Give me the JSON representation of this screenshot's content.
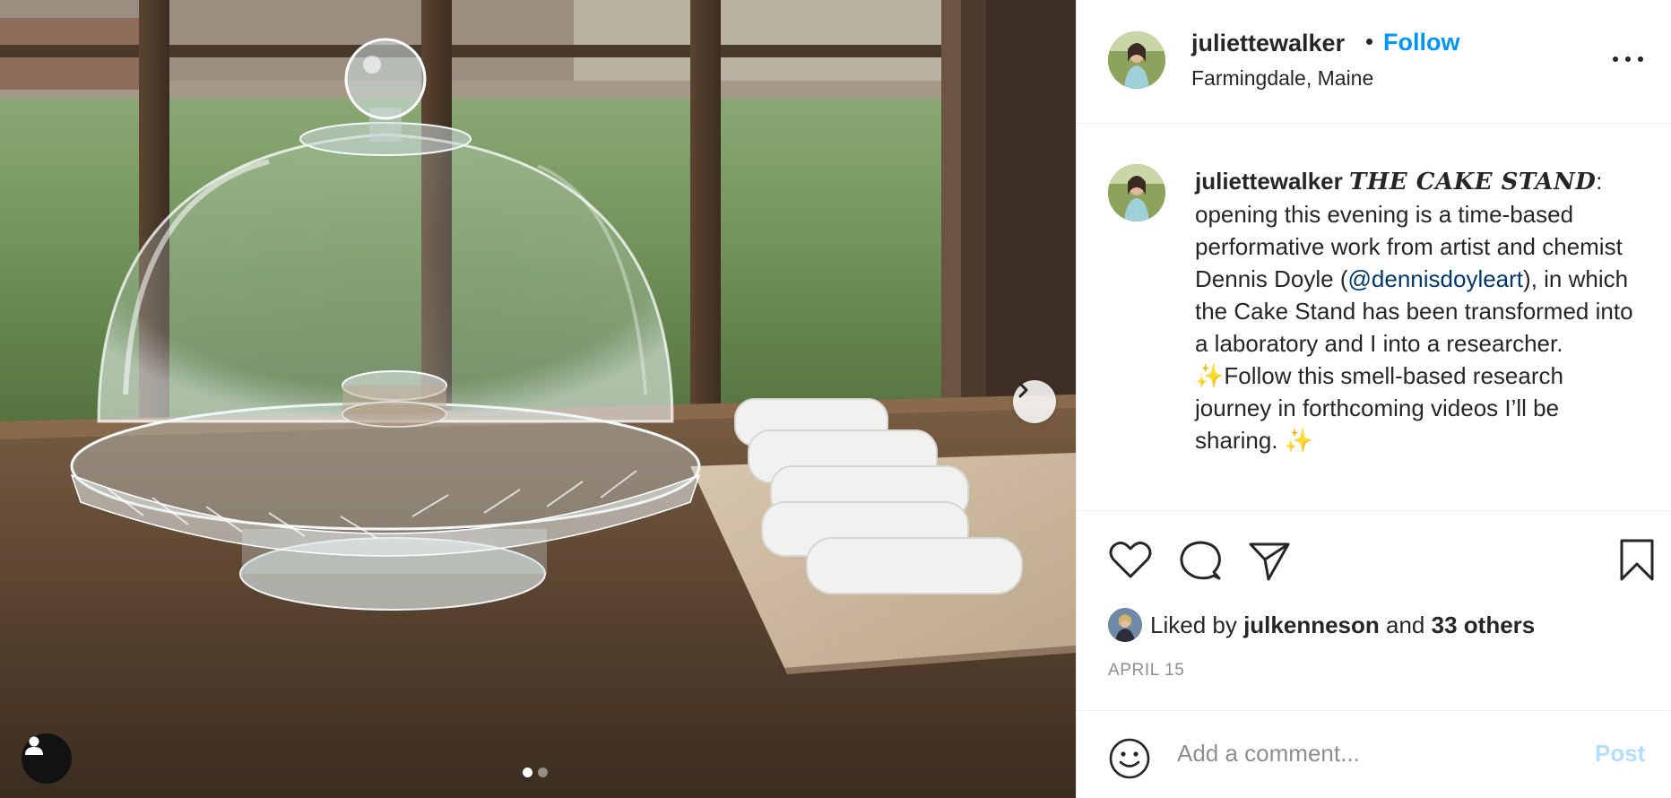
{
  "post": {
    "username": "juliettewalker",
    "separator": "•",
    "follow_label": "Follow",
    "location": "Farmingdale, Maine",
    "more_icon": "more-horizontal-icon"
  },
  "caption": {
    "username": "juliettewalker",
    "title": "THE CAKE STAND",
    "colon": ":",
    "line_a": "opening this evening is a time-based performative work from artist and chemist Dennis Doyle (",
    "mention": "@dennisdoyleart",
    "line_b": "), in which the Cake Stand has been transformed into a laboratory and I into a researcher.",
    "sparkle_1": "✨",
    "line_c": "Follow this smell-based research journey in forthcoming videos I’ll be sharing.",
    "sparkle_2": "✨"
  },
  "actions": {
    "like_icon": "heart-icon",
    "comment_icon": "comment-icon",
    "share_icon": "share-icon",
    "save_icon": "bookmark-icon"
  },
  "likes": {
    "prefix": "Liked by",
    "user": "julkenneson",
    "conj": "and",
    "others": "33 others"
  },
  "date": "APRIL 15",
  "comment": {
    "placeholder": "Add a comment...",
    "post_label": "Post",
    "emoji_icon": "emoji-icon"
  },
  "media": {
    "slide_count": 2,
    "active_slide": 1,
    "next_icon": "chevron-right-icon",
    "tag_icon": "user-icon"
  },
  "colors": {
    "follow": "#0095f6",
    "mention": "#00376b",
    "post_disabled": "#b2dffc",
    "muted": "#8e8e8e"
  }
}
